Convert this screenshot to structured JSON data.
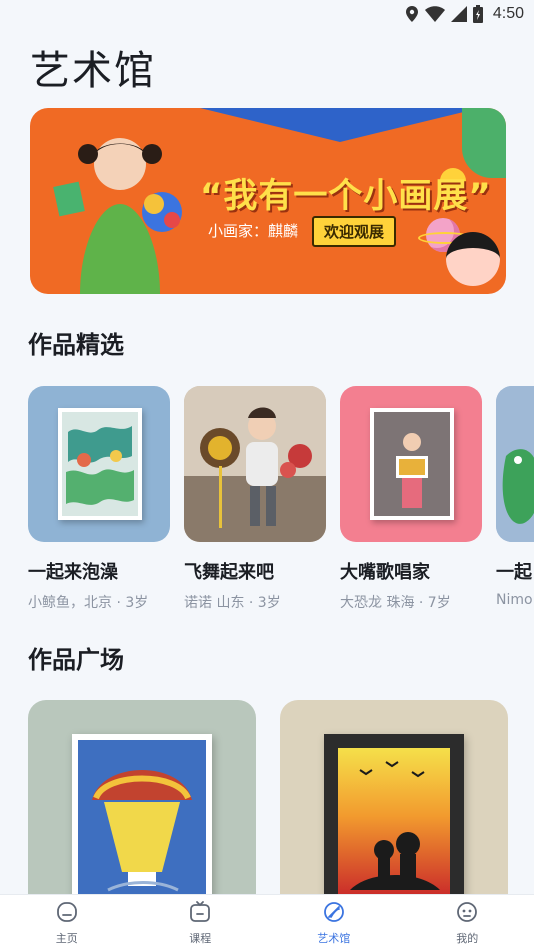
{
  "status_bar": {
    "time": "4:50",
    "icons": [
      "location-icon",
      "wifi-icon",
      "signal-icon",
      "battery-icon"
    ]
  },
  "page": {
    "title": "艺术馆"
  },
  "banner": {
    "headline": "“我有一个小画展”",
    "painter_label": "小画家：麒麟",
    "cta": "欢迎观展"
  },
  "featured": {
    "title": "作品精选",
    "items": [
      {
        "title": "一起来泡澡",
        "meta": "小鲸鱼，北京 · 3岁",
        "bg": "#8fb3d4"
      },
      {
        "title": "飞舞起来吧",
        "meta": "诺诺 山东 · 3岁",
        "bg": "#c9b9a4"
      },
      {
        "title": "大嘴歌唱家",
        "meta": "大恐龙 珠海 · 7岁",
        "bg": "#f37f90"
      },
      {
        "title": "一起",
        "meta": "Nimo",
        "bg": "#9fb9d6"
      }
    ]
  },
  "plaza": {
    "title": "作品广场",
    "items": [
      {
        "bg": "#b9c7bc"
      },
      {
        "bg": "#dcd3bd"
      }
    ]
  },
  "tabbar": {
    "tabs": [
      {
        "label": "主页",
        "icon": "home-icon",
        "active": false
      },
      {
        "label": "课程",
        "icon": "tv-icon",
        "active": false
      },
      {
        "label": "艺术馆",
        "icon": "gallery-icon",
        "active": true
      },
      {
        "label": "我的",
        "icon": "profile-face-icon",
        "active": false
      }
    ],
    "active_color": "#3b74e0"
  }
}
